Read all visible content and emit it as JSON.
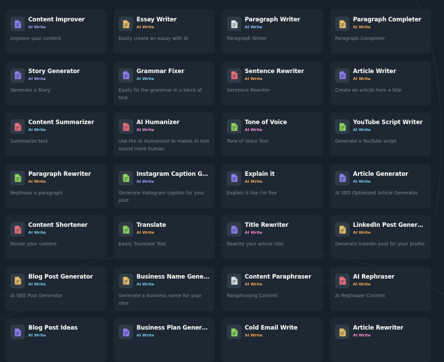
{
  "tools": [
    {
      "title": "Content Improver",
      "tag": "AI Write",
      "desc": "Improve your content",
      "icon": "purple-doc-icon",
      "color": "#8b7ff0",
      "tagColor": "#9d9cf2"
    },
    {
      "title": "Essay Writer",
      "tag": "AI Write",
      "desc": "Easily create an essay with AI",
      "icon": "yellow-doc-icon",
      "color": "#e8c06a",
      "tagColor": "#f2a25a"
    },
    {
      "title": "Paragraph Writer",
      "tag": "AI Write",
      "desc": "Paragraph Writer",
      "icon": "gray-doc-icon",
      "color": "#dfe3e8",
      "tagColor": "#8fb8f5"
    },
    {
      "title": "Paragraph Completer",
      "tag": "AI Write",
      "desc": "Paragraph Completer",
      "icon": "yellow-doc-icon",
      "color": "#e8c06a",
      "tagColor": "#f2a25a"
    },
    {
      "title": "Story Generator",
      "tag": "AI Write",
      "desc": "Generate a Story",
      "icon": "purple-doc-icon",
      "color": "#8b7ff0",
      "tagColor": "#9d9cf2"
    },
    {
      "title": "Grammar Fixer",
      "tag": "AI Write",
      "desc": "Easily fix the grammar in a block of text",
      "icon": "purple-doc-icon",
      "color": "#8b7ff0",
      "tagColor": "#76c4e6"
    },
    {
      "title": "Sentence Rewriter",
      "tag": "AI Write",
      "desc": "Sentence Rewriter",
      "icon": "red-doc-icon",
      "color": "#ec6f7d",
      "tagColor": "#f2a25a"
    },
    {
      "title": "Article Writer",
      "tag": "AI Write",
      "desc": "Create an article from a title",
      "icon": "purple-doc-icon",
      "color": "#8b7ff0",
      "tagColor": "#f2a25a"
    },
    {
      "title": "Content Summarizer",
      "tag": "AI Write",
      "desc": "Summarize text",
      "icon": "red-doc-icon",
      "color": "#ec6f7d",
      "tagColor": "#76c4e6"
    },
    {
      "title": "AI Humanizer",
      "tag": "AI Write",
      "desc": "Use the AI Humanizer to makes AI text sound more human",
      "icon": "red-doc-icon",
      "color": "#ec6f7d",
      "tagColor": "#ee8dcb"
    },
    {
      "title": "Tone of Voice",
      "tag": "AI Write",
      "desc": "Tone of Voice Tool",
      "icon": "green-doc-icon",
      "color": "#8fd65f",
      "tagColor": "#ee8dcb"
    },
    {
      "title": "YouTube Script Writer",
      "tag": "AI Write",
      "desc": "Generate a YouTube script",
      "icon": "green-doc-icon",
      "color": "#8fd65f",
      "tagColor": "#76c4e6"
    },
    {
      "title": "Paragraph Rewriter",
      "tag": "AI Write",
      "desc": "Rephrase a paragraph",
      "icon": "green-doc-icon",
      "color": "#8fd65f",
      "tagColor": "#f2a25a"
    },
    {
      "title": "Instagram Caption Gener...",
      "tag": "AI Write",
      "desc": "Generate instagram caption for your post",
      "icon": "green-doc-icon",
      "color": "#8fd65f",
      "tagColor": "#9d9cf2"
    },
    {
      "title": "Explain it",
      "tag": "AI Write",
      "desc": "Explain it like i'm five",
      "icon": "purple-doc-icon",
      "color": "#8b7ff0",
      "tagColor": "#f2a25a"
    },
    {
      "title": "Article Generator",
      "tag": "AI Write",
      "desc": "AI SEO Optimized Article Generator",
      "icon": "purple-doc-icon",
      "color": "#8b7ff0",
      "tagColor": "#76c4e6"
    },
    {
      "title": "Content Shortener",
      "tag": "AI Write",
      "desc": "Resize your content",
      "icon": "red-doc-icon",
      "color": "#ec6f7d",
      "tagColor": "#76c4e6"
    },
    {
      "title": "Translate",
      "tag": "AI Write",
      "desc": "Easily Translate Text",
      "icon": "green-doc-icon",
      "color": "#8fd65f",
      "tagColor": "#f2a25a"
    },
    {
      "title": "Title Rewriter",
      "tag": "AI Write",
      "desc": "Rewrite your article title",
      "icon": "purple-doc-icon",
      "color": "#8b7ff0",
      "tagColor": "#ee8dcb"
    },
    {
      "title": "LinkedIn Post Generator",
      "tag": "AI Write",
      "desc": "Generate linkedin post for your profile",
      "icon": "yellow-doc-icon",
      "color": "#e8c06a",
      "tagColor": "#f2a25a"
    },
    {
      "title": "Blog Post Generator",
      "tag": "AI Write",
      "desc": "AI SEO Post Generator",
      "icon": "yellow-doc-icon",
      "color": "#e8c06a",
      "tagColor": "#76c4e6"
    },
    {
      "title": "Business Name Generator",
      "tag": "AI Write",
      "desc": "Generate a business name for your idea",
      "icon": "yellow-doc-icon",
      "color": "#e8c06a",
      "tagColor": "#76c4e6"
    },
    {
      "title": "Content Paraphraser",
      "tag": "AI Write",
      "desc": "Paraphrasing Content",
      "icon": "gray-doc-icon",
      "color": "#dfe3e8",
      "tagColor": "#f2a25a"
    },
    {
      "title": "AI Rephraser",
      "tag": "AI Write",
      "desc": "AI Rephraser Content",
      "icon": "red-doc-icon",
      "color": "#ec6f7d",
      "tagColor": "#f2a25a"
    },
    {
      "title": "Blog Post Ideas",
      "tag": "AI Write",
      "desc": "",
      "icon": "purple-doc-icon",
      "color": "#8b7ff0",
      "tagColor": "#76c4e6"
    },
    {
      "title": "Business Plan Generator",
      "tag": "AI Write",
      "desc": "",
      "icon": "purple-doc-icon",
      "color": "#8b7ff0",
      "tagColor": "#76c4e6"
    },
    {
      "title": "Cold Email Write",
      "tag": "AI Write",
      "desc": "",
      "icon": "green-doc-icon",
      "color": "#8fd65f",
      "tagColor": "#f2a25a"
    },
    {
      "title": "Article Rewriter",
      "tag": "AI Write",
      "desc": "",
      "icon": "yellow-doc-icon",
      "color": "#e8c06a",
      "tagColor": "#ee8dcb"
    }
  ]
}
